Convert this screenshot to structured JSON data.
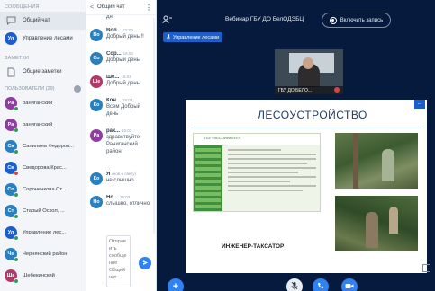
{
  "colors": {
    "accent": "#2f82f4",
    "stage_bg": "#061a3d",
    "online": "#2d9c5e",
    "muted": "#d64444"
  },
  "nav": {
    "messages_title": "СООБЩЕНИЯ",
    "chat_item": {
      "label": "Общий чат",
      "icon": "chat-bubble-icon"
    },
    "room_item": {
      "label": "Управление лесами",
      "initials": "Ул",
      "color": "#1d5fc9"
    },
    "notes_title": "ЗАМЕТКИ",
    "notes_item": {
      "label": "Общие заметки",
      "icon": "notes-icon"
    },
    "users_title": "ПОЛЬЗОВАТЕЛИ (29)"
  },
  "users": [
    {
      "initials": "Ра",
      "name": "раниганский",
      "color": "#8e3e9e",
      "status": "online"
    },
    {
      "initials": "Ра",
      "name": "раниганский",
      "color": "#8e3e9e",
      "status": "online"
    },
    {
      "initials": "Са",
      "name": "Сапилина Федоров...",
      "color": "#2a7fbf",
      "status": "online"
    },
    {
      "initials": "Св",
      "name": "Сведорова Крас...",
      "color": "#1d5fc9",
      "status": "muted"
    },
    {
      "initials": "Со",
      "name": "Сороненкова Ст...",
      "color": "#2a7fbf",
      "status": "online"
    },
    {
      "initials": "Ст",
      "name": "Старый Оскол, ...",
      "color": "#2a7fbf",
      "status": "online"
    },
    {
      "initials": "Ул",
      "name": "Управление лес...",
      "color": "#1d5fc9",
      "status": "online"
    },
    {
      "initials": "Че",
      "name": "Чернянский район",
      "color": "#2a7fbf",
      "status": "online"
    },
    {
      "initials": "Ше",
      "name": "Шебекинский",
      "color": "#b03a6a",
      "status": "online"
    }
  ],
  "chat": {
    "back_label": "<",
    "title": "Общий чат",
    "more_label": "⋮",
    "input_placeholder": "Отправить сообщение Общий чат",
    "send_icon": "send-icon",
    "messages": [
      {
        "initials": "",
        "color": "#2a7fbf",
        "name": "",
        "time": "",
        "text": "дя"
      },
      {
        "initials": "Во",
        "color": "#2a7fbf",
        "name": "Вол...",
        "time": "15:03",
        "text": "Добрый день!!!"
      },
      {
        "initials": "Со",
        "color": "#2a7fbf",
        "name": "Сор...",
        "time": "15:03",
        "text": "Добрый день"
      },
      {
        "initials": "Ше",
        "color": "#b03a6a",
        "name": "Ше...",
        "time": "15:03",
        "text": "Добрый день"
      },
      {
        "initials": "Ко",
        "color": "#2a7fbf",
        "name": "Кон...",
        "time": "15:03",
        "text": "Всем Добрый день"
      },
      {
        "initials": "Ра",
        "color": "#8e3e9e",
        "name": "рак...",
        "time": "15:03",
        "text": "здравствуйте Раниганский район"
      },
      {
        "initials": "Ко",
        "color": "#2a7fbf",
        "name": "Я",
        "time": "(нов а свету)",
        "text": "не слышно"
      },
      {
        "initials": "Но",
        "color": "#2a7fbf",
        "name": "Но...",
        "time": "15:03",
        "text": "слышно, отлично"
      }
    ]
  },
  "stage": {
    "users_icon": "users-icon",
    "meeting_title": "Вебинар ГБУ ДО БелОДЭБЦ",
    "record_label": "Включить запись",
    "badge_label": "Управление лесами",
    "video_name": "ГБУ ДО БЕЛО..."
  },
  "slide": {
    "title": "ЛЕСОУСТРОЙСТВО",
    "menu_label": "...",
    "site_name": "ГБУ «ЛЕСОИНВЕНТ»",
    "caption": "ИНЖЕНЕР-ТАКСАТОР"
  },
  "controls": {
    "plus_icon": "plus-icon",
    "mic_icon": "microphone-icon",
    "phone_icon": "phone-icon",
    "camera_icon": "camera-icon"
  }
}
